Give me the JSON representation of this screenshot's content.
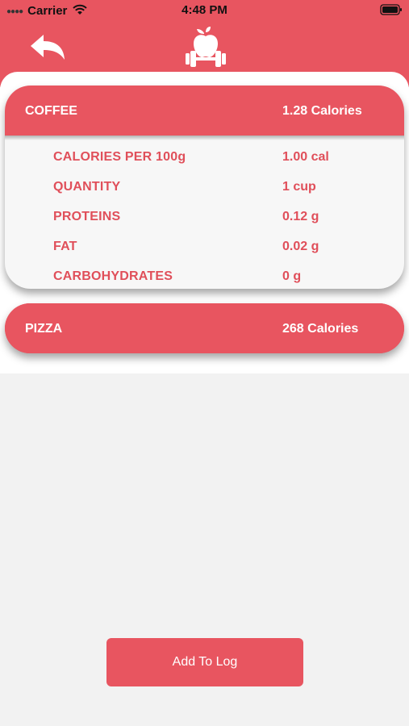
{
  "status_bar": {
    "carrier": "Carrier",
    "time": "4:48 PM"
  },
  "header": {
    "back_icon": "back-arrow-icon",
    "logo_icon": "apple-dumbbell-logo-icon"
  },
  "foods": [
    {
      "name": "COFFEE",
      "calories": "1.28 Calories",
      "expanded": true,
      "details": [
        {
          "label": "CALORIES PER 100g",
          "value": "1.00 cal"
        },
        {
          "label": "QUANTITY",
          "value": "1  cup"
        },
        {
          "label": "PROTEINS",
          "value": "0.12  g"
        },
        {
          "label": "FAT",
          "value": "0.02  g"
        },
        {
          "label": "CARBOHYDRATES",
          "value": "0  g"
        }
      ]
    },
    {
      "name": "PIZZA",
      "calories": "268 Calories",
      "expanded": false
    }
  ],
  "actions": {
    "add_to_log_label": "Add To Log"
  },
  "colors": {
    "accent": "#e85560",
    "accent_text": "#e04f5a",
    "background": "#f2f2f2"
  }
}
